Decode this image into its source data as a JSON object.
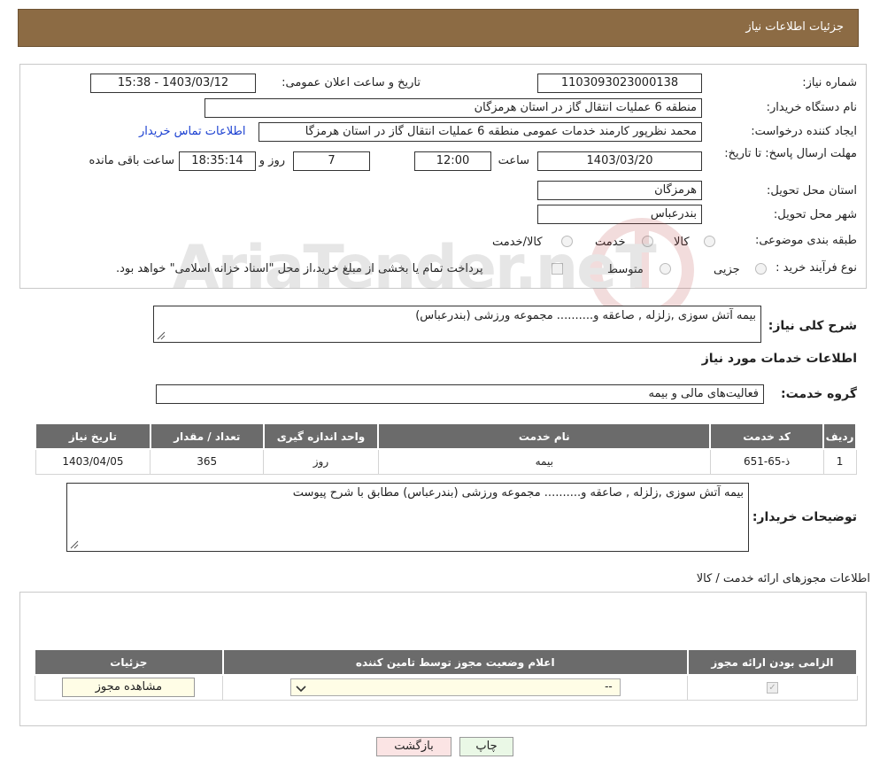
{
  "header": {
    "title": "جزئیات اطلاعات نیاز"
  },
  "form": {
    "need_number_label": "شماره نیاز:",
    "need_number": "1103093023000138",
    "announce_label": "تاریخ و ساعت اعلان عمومی:",
    "announce_value": "1403/03/12 - 15:38",
    "buyer_org_label": "نام دستگاه خریدار:",
    "buyer_org": "منطقه 6 عملیات انتقال گاز در استان هرمزگان",
    "creator_label": "ایجاد کننده درخواست:",
    "creator": "محمد نظرپور کارمند خدمات عمومی منطقه 6 عملیات انتقال گاز در استان هرمزگا",
    "contact_link": "اطلاعات تماس خریدار",
    "deadline_label": "مهلت ارسال پاسخ: تا تاریخ:",
    "deadline_date": "1403/03/20",
    "time_label": "ساعت",
    "deadline_time": "12:00",
    "days_value": "7",
    "days_label": "روز و",
    "remaining_time": "18:35:14",
    "remaining_label": "ساعت باقی مانده",
    "province_label": "استان محل تحویل:",
    "province": "هرمزگان",
    "city_label": "شهر محل تحویل:",
    "city": "بندرعباس",
    "category_label": "طبقه بندی موضوعی:",
    "category_options": [
      "کالا",
      "خدمت",
      "کالا/خدمت"
    ],
    "process_label": "نوع فرآیند خرید :",
    "process_options": [
      "جزیی",
      "متوسط"
    ],
    "payment_note": "پرداخت تمام یا بخشی از مبلغ خرید،از محل \"اسناد خزانه اسلامی\" خواهد بود."
  },
  "summary": {
    "label": "شرح کلی نیاز:",
    "value": "بیمه آتش سوزی ,زلزله , صاعقه و.......... مجموعه ورزشی (بندرعباس)"
  },
  "services": {
    "section_title": "اطلاعات خدمات مورد نیاز",
    "group_label": "گروه خدمت:",
    "group_value": "فعالیت‌های مالی و بیمه",
    "columns": [
      "ردیف",
      "کد خدمت",
      "نام خدمت",
      "واحد اندازه گیری",
      "تعداد / مقدار",
      "تاریخ نیاز"
    ],
    "rows": [
      [
        "1",
        "ذ-65-651",
        "بیمه",
        "روز",
        "365",
        "1403/04/05"
      ]
    ]
  },
  "buyer_notes": {
    "label": "توضیحات خریدار:",
    "value": "بیمه آتش سوزی ,زلزله , صاعقه و.......... مجموعه ورزشی (بندرعباس) مطابق با شرح پیوست"
  },
  "permits": {
    "section_title": "اطلاعات مجوزهای ارائه خدمت / کالا",
    "columns": [
      "الزامی بودن ارائه مجوز",
      "اعلام وضعیت مجوز توسط تامین کننده",
      "جزئیات"
    ],
    "select_value": "--",
    "view_button": "مشاهده مجوز"
  },
  "actions": {
    "print": "چاپ",
    "back": "بازگشت"
  },
  "watermark_text": "AriaTender.neT"
}
